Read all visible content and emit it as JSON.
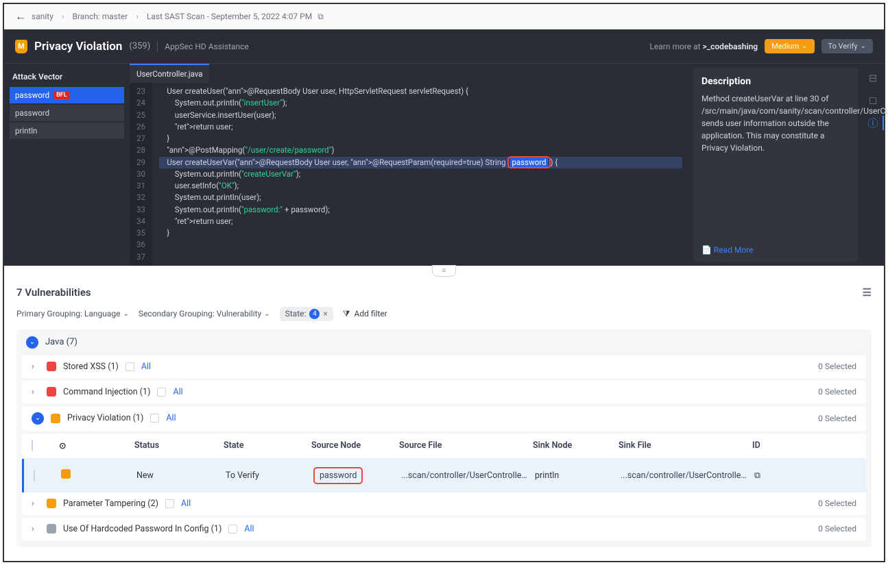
{
  "breadcrumb": {
    "project": "sanity",
    "branch_label": "Branch: master",
    "scan": "Last SAST Scan - September 5, 2022 4:07 PM"
  },
  "header": {
    "title": "Privacy Violation",
    "count": "(359)",
    "assist": "AppSec HD Assistance",
    "learn_prefix": "Learn more at ",
    "learn_link": ">_codebashing",
    "severity_badge": "Medium",
    "state_badge": "To Verify"
  },
  "attack_vector": {
    "heading": "Attack Vector",
    "items": [
      {
        "label": "password",
        "tag": "BFL",
        "active": true
      },
      {
        "label": "password",
        "active": false
      },
      {
        "label": "println",
        "active": false
      }
    ]
  },
  "code": {
    "tab": "UserController.java",
    "lines_start": 23,
    "lines": [
      "    User createUser(@RequestBody User user, HttpServletRequest servletRequest) {",
      "        System.out.println(\"insertUser\");",
      "        userService.insertUser(user);",
      "        return user;",
      "    }",
      "",
      "    @PostMapping(\"/user/create/password\")",
      "    User createUserVar(@RequestBody User user, @RequestParam(required=true) String password) {",
      "        System.out.println(\"createUserVar\");",
      "        user.setInfo(\"OK\");",
      "        System.out.println(user);",
      "        System.out.println(\"password:\" + password);",
      "        return user;",
      "    }",
      ""
    ],
    "highlight_line_index": 7,
    "highlight_word": "password"
  },
  "description": {
    "heading": "Description",
    "text": "Method createUserVar at line 30 of /src/main/java/com/sanity/scan/controller/UserCon sends user information outside the application. This may constitute a Privacy Violation.",
    "read_more": "Read More"
  },
  "vuln_section": {
    "heading": "7 Vulnerabilities",
    "primary_group": "Primary Grouping: Language",
    "secondary_group": "Secondary Grouping: Vulnerability",
    "state_label": "State:",
    "state_count": "4",
    "add_filter": "Add filter",
    "lang_group": "Java (7)",
    "rows": [
      {
        "name": "Stored XSS (1)",
        "sev": "high",
        "all": "All",
        "selected": "0 Selected",
        "open": false
      },
      {
        "name": "Command Injection (1)",
        "sev": "high",
        "all": "All",
        "selected": "0 Selected",
        "open": false
      },
      {
        "name": "Privacy Violation (1)",
        "sev": "med",
        "all": "All",
        "selected": "0 Selected",
        "open": true
      },
      {
        "name": "Parameter Tampering (2)",
        "sev": "med",
        "all": "All",
        "selected": "0 Selected",
        "open": false
      },
      {
        "name": "Use Of Hardcoded Password In Config (1)",
        "sev": "low",
        "all": "All",
        "selected": "0 Selected",
        "open": false
      }
    ],
    "columns": {
      "status": "Status",
      "state": "State",
      "source_node": "Source Node",
      "source_file": "Source File",
      "sink_node": "Sink Node",
      "sink_file": "Sink File",
      "id": "ID"
    },
    "detail": {
      "status": "New",
      "state": "To Verify",
      "source_node": "password",
      "source_file": "...scan/controller/UserController.java",
      "sink_node": "println",
      "sink_file": "...scan/controller/UserController.java"
    }
  }
}
